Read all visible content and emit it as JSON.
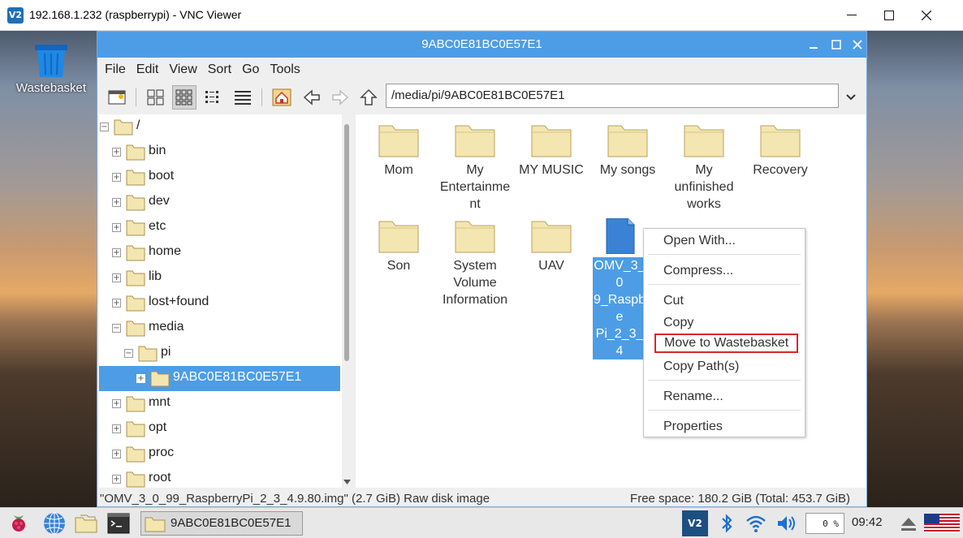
{
  "vnc": {
    "title": "192.168.1.232 (raspberrypi) - VNC Viewer",
    "logo": "V2"
  },
  "desktop": {
    "wastebasket_label": "Wastebasket"
  },
  "file_manager": {
    "title": "9ABC0E81BC0E57E1",
    "menus": [
      "File",
      "Edit",
      "View",
      "Sort",
      "Go",
      "Tools"
    ],
    "path": "/media/pi/9ABC0E81BC0E57E1",
    "tree": [
      {
        "label": "/",
        "expander": "−"
      },
      {
        "label": "bin",
        "expander": "+"
      },
      {
        "label": "boot",
        "expander": "+"
      },
      {
        "label": "dev",
        "expander": "+"
      },
      {
        "label": "etc",
        "expander": "+"
      },
      {
        "label": "home",
        "expander": "+"
      },
      {
        "label": "lib",
        "expander": "+"
      },
      {
        "label": "lost+found",
        "expander": "+"
      },
      {
        "label": "media",
        "expander": "−"
      },
      {
        "label": "pi",
        "expander": "−"
      },
      {
        "label": "9ABC0E81BC0E57E1",
        "expander": "+"
      },
      {
        "label": "mnt",
        "expander": "+"
      },
      {
        "label": "opt",
        "expander": "+"
      },
      {
        "label": "proc",
        "expander": "+"
      },
      {
        "label": "root",
        "expander": "+"
      }
    ],
    "items": [
      {
        "label": "Mom",
        "type": "folder"
      },
      {
        "label": "My Entertainme nt",
        "type": "folder"
      },
      {
        "label": "MY MUSIC",
        "type": "folder"
      },
      {
        "label": "My songs",
        "type": "folder"
      },
      {
        "label": "My unfinished works",
        "type": "folder"
      },
      {
        "label": "Recovery",
        "type": "folder"
      },
      {
        "label": "Son",
        "type": "folder"
      },
      {
        "label": "System Volume Information",
        "type": "folder"
      },
      {
        "label": "UAV",
        "type": "folder"
      },
      {
        "label": "OMV_3_0 9_Raspbe Pi_2_3_4",
        "type": "file"
      }
    ],
    "context_menu": [
      "Open With...",
      "Compress...",
      "Cut",
      "Copy",
      "Move to Wastebasket",
      "Copy Path(s)",
      "Rename...",
      "Properties"
    ],
    "status_left": "\"OMV_3_0_99_RaspberryPi_2_3_4.9.80.img\" (2.7 GiB) Raw disk image",
    "status_right": "Free space: 180.2 GiB (Total: 453.7 GiB)"
  },
  "taskbar": {
    "window_label": "9ABC0E81BC0E57E1",
    "tray_vnc": "V2",
    "cpu": "0 %",
    "clock": "09:42"
  },
  "colors": {
    "accent": "#4d9de6",
    "highlight_box": "#d9262a",
    "folder": "#f3e6b0"
  }
}
